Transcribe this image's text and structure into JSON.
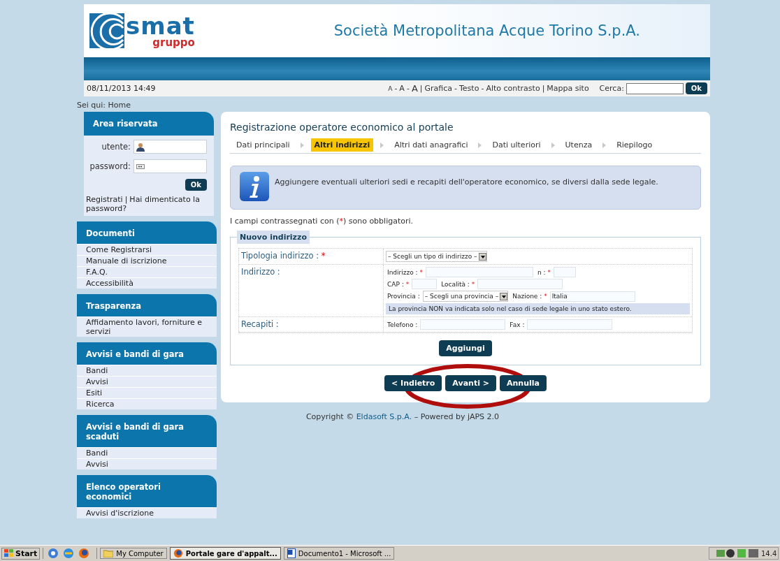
{
  "header": {
    "logo_name": "smat",
    "logo_sub": "gruppo",
    "company": "Società Metropolitana Acque Torino S.p.A."
  },
  "infobar": {
    "date": "08/11/2013 14:49",
    "link_separator": "-",
    "group_separator": "|",
    "link_groups": [
      [
        {
          "label": "A",
          "kind": "small"
        },
        {
          "label": "A",
          "kind": "medium"
        },
        {
          "label": "A",
          "kind": "large"
        }
      ],
      [
        {
          "label": "Grafica",
          "kind": "text"
        },
        {
          "label": "Testo",
          "kind": "text"
        },
        {
          "label": "Alto contrasto",
          "kind": "text"
        }
      ],
      [
        {
          "label": "Mappa sito",
          "kind": "text"
        }
      ]
    ],
    "search_label": "Cerca:",
    "search_button": "Ok"
  },
  "breadcrumb": "Sei qui: Home",
  "login": {
    "title": "Area riservata",
    "user_label": "utente:",
    "password_label": "password:",
    "button": "Ok",
    "register_link": "Registrati",
    "separator": "|",
    "forgot_link": "Hai dimenticato la password?"
  },
  "sidebar_menus": [
    {
      "title": "Documenti",
      "items": [
        "Come Registrarsi",
        "Manuale di iscrizione",
        "F.A.Q.",
        "Accessibilità"
      ]
    },
    {
      "title": "Trasparenza",
      "items": [
        "Affidamento lavori, forniture e servizi"
      ]
    },
    {
      "title": "Avvisi e bandi di gara",
      "items": [
        "Bandi",
        "Avvisi",
        "Esiti",
        "Ricerca"
      ]
    },
    {
      "title": "Avvisi e bandi di gara scaduti",
      "items": [
        "Bandi",
        "Avvisi"
      ]
    },
    {
      "title": "Elenco operatori economici",
      "items": [
        "Avvisi d'iscrizione"
      ]
    }
  ],
  "main": {
    "title": "Registrazione operatore economico al portale",
    "steps": [
      {
        "label": "Dati principali",
        "selected": false
      },
      {
        "label": "Altri indirizzi",
        "selected": true
      },
      {
        "label": "Altri dati anagrafici",
        "selected": false
      },
      {
        "label": "Dati ulteriori",
        "selected": false
      },
      {
        "label": "Utenza",
        "selected": false
      },
      {
        "label": "Riepilogo",
        "selected": false
      }
    ],
    "info_message": "Aggiungere eventuali ulteriori sedi e recapiti dell'operatore economico, se diversi dalla sede legale.",
    "required_note": {
      "before": "I campi contrassegnati con (",
      "mark": "*",
      "after": ") sono obbligatori."
    },
    "fieldset": {
      "legend": "Nuovo indirizzo",
      "rows": [
        {
          "label": "Tipologia indirizzo :",
          "required": true,
          "lines": [
            [
              {
                "kind": "select",
                "value": "– Scegli un tipo di indirizzo –"
              }
            ]
          ]
        },
        {
          "label": "Indirizzo :",
          "required": false,
          "lines": [
            [
              {
                "kind": "input",
                "label": "Indirizzo :",
                "required": true
              },
              {
                "kind": "input",
                "label": "n :",
                "required": true
              }
            ],
            [
              {
                "kind": "input",
                "label": "CAP :",
                "required": true
              },
              {
                "kind": "input",
                "label": "Località :",
                "required": true
              }
            ],
            [
              {
                "kind": "select",
                "label": "Provincia :",
                "required": false,
                "value": "– Scegli una provincia –"
              },
              {
                "kind": "input",
                "label": "Nazione :",
                "required": true,
                "value": "Italia"
              }
            ]
          ],
          "note": "La provincia NON va indicata solo nel caso di sede legale in uno stato estero."
        },
        {
          "label": "Recapiti :",
          "required": false,
          "lines": [
            [
              {
                "kind": "input",
                "label": "Telefono :",
                "required": false
              },
              {
                "kind": "input",
                "label": "Fax :",
                "required": false
              }
            ]
          ]
        }
      ],
      "add_button": "Aggiungi"
    },
    "nav_buttons": [
      "< Indietro",
      "Avanti >",
      "Annulla"
    ]
  },
  "footer": {
    "before": "Copyright © ",
    "link": "Eldasoft S.p.A.",
    "after": " – Powered by jAPS 2.0"
  },
  "taskbar": {
    "start": "Start",
    "tasks": [
      {
        "label": "My Computer",
        "selected": false
      },
      {
        "label": "Portale gare d'appalt...",
        "selected": true
      },
      {
        "label": "Documento1 - Microsoft ...",
        "selected": false
      }
    ],
    "clock": "14.4"
  }
}
